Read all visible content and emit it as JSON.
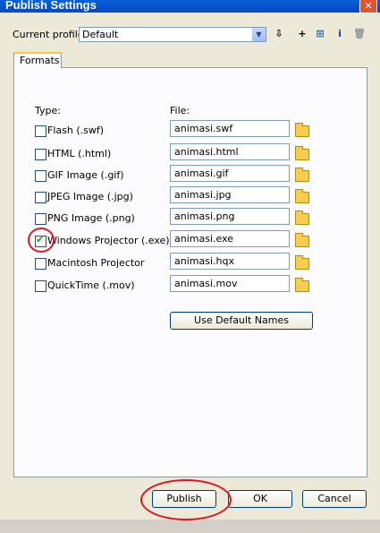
{
  "window": {
    "title": "Publish Settings"
  },
  "profile": {
    "label": "Current profile:",
    "value": "Default"
  },
  "tabs": [
    {
      "label": "Formats"
    }
  ],
  "headers": {
    "type": "Type:",
    "file": "File:"
  },
  "formats": [
    {
      "label": "Flash  (.swf)",
      "checked": false,
      "file": "animasi.swf"
    },
    {
      "label": "HTML  (.html)",
      "checked": false,
      "file": "animasi.html"
    },
    {
      "label": "GIF Image  (.gif)",
      "checked": false,
      "file": "animasi.gif"
    },
    {
      "label": "JPEG Image  (.jpg)",
      "checked": false,
      "file": "animasi.jpg"
    },
    {
      "label": "PNG Image  (.png)",
      "checked": false,
      "file": "animasi.png"
    },
    {
      "label": "Windows Projector  (.exe)",
      "checked": true,
      "file": "animasi.exe"
    },
    {
      "label": "Macintosh Projector",
      "checked": false,
      "file": "animasi.hqx"
    },
    {
      "label": "QuickTime  (.mov)",
      "checked": false,
      "file": "animasi.mov"
    }
  ],
  "buttons": {
    "default_names": "Use Default Names",
    "publish": "Publish",
    "ok": "OK",
    "cancel": "Cancel"
  },
  "toolbar_icons": [
    "import-export-icon",
    "add-icon",
    "duplicate-icon",
    "info-icon",
    "delete-icon"
  ]
}
